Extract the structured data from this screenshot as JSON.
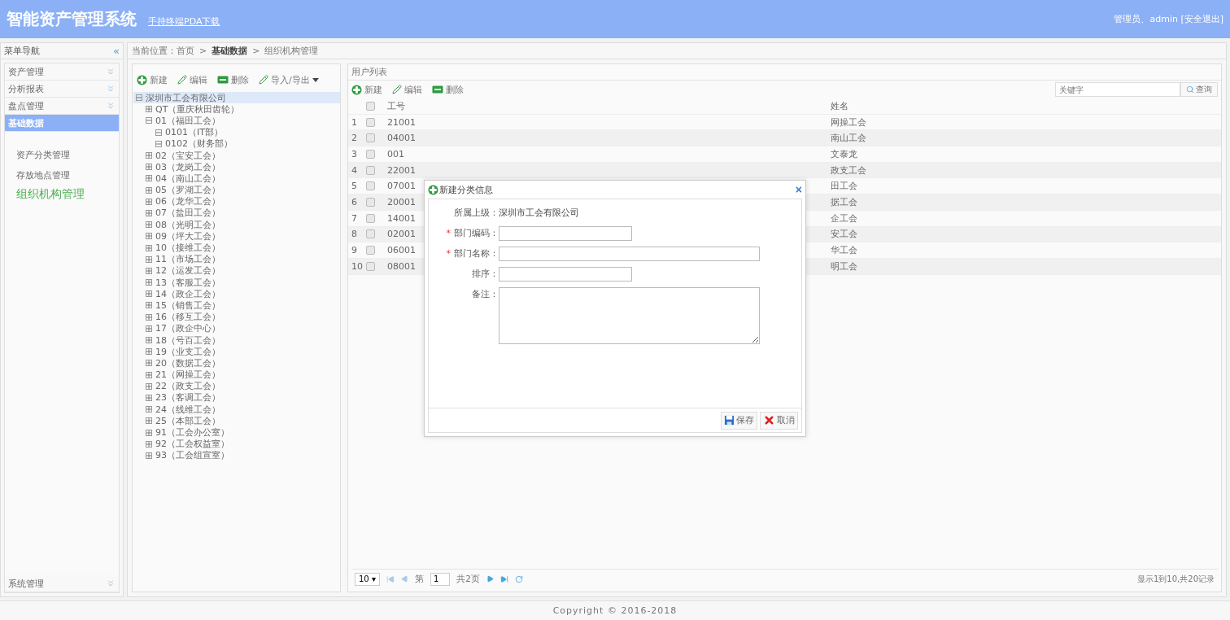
{
  "header": {
    "title": "智能资产管理系统",
    "download_link": "手持终端PDA下载",
    "user": "管理员、admin",
    "logout": "[安全退出]"
  },
  "sidebar": {
    "title": "菜单导航",
    "collapse": "«",
    "groups": [
      {
        "label": "资产管理",
        "expanded": false
      },
      {
        "label": "分析报表",
        "expanded": false
      },
      {
        "label": "盘点管理",
        "expanded": false
      },
      {
        "label": "基础数据",
        "expanded": true,
        "children": [
          {
            "label": "资产分类管理",
            "selected": false
          },
          {
            "label": "存放地点管理",
            "selected": false
          },
          {
            "label": "组织机构管理",
            "selected": true
          }
        ]
      }
    ],
    "bottom_group": {
      "label": "系统管理",
      "expanded": false
    }
  },
  "breadcrumb": [
    {
      "label": "当前位置：首页",
      "current": false
    },
    {
      "label": ">",
      "current": false
    },
    {
      "label": "基础数据",
      "current": true
    },
    {
      "label": ">",
      "current": false
    },
    {
      "label": "组织机构管理",
      "current": false
    }
  ],
  "tree_toolbar": [
    {
      "kind": "add",
      "label": "新建"
    },
    {
      "kind": "edit",
      "label": "编辑"
    },
    {
      "kind": "delete",
      "label": "删除"
    },
    {
      "kind": "io",
      "label": "导入/导出"
    }
  ],
  "tree": [
    {
      "label": "深圳市工会有限公司",
      "expanded": true,
      "selected": true,
      "children": [
        {
          "label": "QT（重庆秋田齿轮）",
          "expanded": false,
          "selected": false
        },
        {
          "label": "01（福田工会）",
          "expanded": true,
          "selected": false,
          "children": [
            {
              "label": "0101（IT部）",
              "expanded": true,
              "selected": false
            },
            {
              "label": "0102（财务部）",
              "expanded": true,
              "selected": false
            }
          ]
        },
        {
          "label": "02（宝安工会）",
          "expanded": false,
          "selected": false
        },
        {
          "label": "03（龙岗工会）",
          "expanded": false,
          "selected": false
        },
        {
          "label": "04（南山工会）",
          "expanded": false,
          "selected": false
        },
        {
          "label": "05（罗湖工会）",
          "expanded": false,
          "selected": false
        },
        {
          "label": "06（龙华工会）",
          "expanded": false,
          "selected": false
        },
        {
          "label": "07（盐田工会）",
          "expanded": false,
          "selected": false
        },
        {
          "label": "08（光明工会）",
          "expanded": false,
          "selected": false
        },
        {
          "label": "09（坪大工会）",
          "expanded": false,
          "selected": false
        },
        {
          "label": "10（接维工会）",
          "expanded": false,
          "selected": false
        },
        {
          "label": "11（市场工会）",
          "expanded": false,
          "selected": false
        },
        {
          "label": "12（运发工会）",
          "expanded": false,
          "selected": false
        },
        {
          "label": "13（客服工会）",
          "expanded": false,
          "selected": false
        },
        {
          "label": "14（政企工会）",
          "expanded": false,
          "selected": false
        },
        {
          "label": "15（销售工会）",
          "expanded": false,
          "selected": false
        },
        {
          "label": "16（移互工会）",
          "expanded": false,
          "selected": false
        },
        {
          "label": "17（政企中心）",
          "expanded": false,
          "selected": false
        },
        {
          "label": "18（号百工会）",
          "expanded": false,
          "selected": false
        },
        {
          "label": "19（业支工会）",
          "expanded": false,
          "selected": false
        },
        {
          "label": "20（数据工会）",
          "expanded": false,
          "selected": false
        },
        {
          "label": "21（网操工会）",
          "expanded": false,
          "selected": false
        },
        {
          "label": "22（政支工会）",
          "expanded": false,
          "selected": false
        },
        {
          "label": "23（客调工会）",
          "expanded": false,
          "selected": false
        },
        {
          "label": "24（线维工会）",
          "expanded": false,
          "selected": false
        },
        {
          "label": "25（本部工会）",
          "expanded": false,
          "selected": false
        },
        {
          "label": "91（工会办公室）",
          "expanded": false,
          "selected": false
        },
        {
          "label": "92（工会权益室）",
          "expanded": false,
          "selected": false
        },
        {
          "label": "93（工会组宣室）",
          "expanded": false,
          "selected": false
        }
      ]
    }
  ],
  "user_list": {
    "title": "用户列表",
    "toolbar": [
      {
        "kind": "add",
        "label": "新建"
      },
      {
        "kind": "edit",
        "label": "编辑"
      },
      {
        "kind": "delete",
        "label": "删除"
      }
    ],
    "search": {
      "placeholder": "关键字",
      "button": "查询"
    },
    "select_all_checked": false,
    "columns": [
      "工号",
      "姓名"
    ],
    "rows": [
      {
        "index": "1",
        "checked": false,
        "id": "21001",
        "name": "网操工会"
      },
      {
        "index": "2",
        "checked": false,
        "id": "04001",
        "name": "南山工会"
      },
      {
        "index": "3",
        "checked": false,
        "id": "001",
        "name": "文泰龙"
      },
      {
        "index": "4",
        "checked": false,
        "id": "22001",
        "name": "政支工会"
      },
      {
        "index": "5",
        "checked": false,
        "id": "07001",
        "name": "田工会"
      },
      {
        "index": "6",
        "checked": false,
        "id": "20001",
        "name": "据工会"
      },
      {
        "index": "7",
        "checked": false,
        "id": "14001",
        "name": "企工会"
      },
      {
        "index": "8",
        "checked": false,
        "id": "02001",
        "name": "安工会"
      },
      {
        "index": "9",
        "checked": false,
        "id": "06001",
        "name": "华工会"
      },
      {
        "index": "10",
        "checked": false,
        "id": "08001",
        "name": "明工会"
      }
    ],
    "pager": {
      "page_size": "10",
      "page_size_caret": "▾",
      "page_label": "第",
      "page": "1",
      "total_pages": "共2页",
      "summary": "显示1到10,共20记录"
    }
  },
  "dialog": {
    "title": "新建分类信息",
    "close": "×",
    "required_mark": "*",
    "fields": [
      {
        "kind": "static",
        "label": "所属上级：",
        "value": "深圳市工会有限公司",
        "required": false
      },
      {
        "kind": "short",
        "label": "部门编码：",
        "required": true
      },
      {
        "kind": "wide",
        "label": "部门名称：",
        "required": true
      },
      {
        "kind": "short",
        "label": "排序：",
        "required": false
      },
      {
        "kind": "textarea",
        "label": "备注：",
        "required": false
      }
    ],
    "buttons": [
      {
        "kind": "save",
        "label": "保存"
      },
      {
        "kind": "cancel",
        "label": "取消"
      }
    ]
  },
  "footer": "Copyright © 2016-2018"
}
